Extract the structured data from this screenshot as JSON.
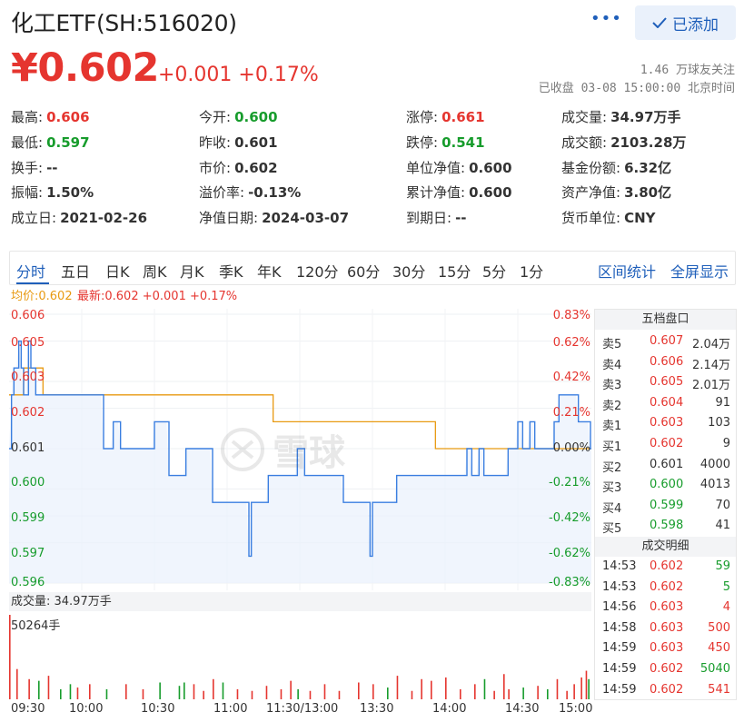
{
  "header": {
    "title": "化工ETF(SH:516020)",
    "more": "•••",
    "added_label": "已添加",
    "price": "¥0.602",
    "change": "+0.001 +0.17%",
    "followers": "1.46 万球友关注",
    "status": "已收盘 03-08 15:00:00 北京时间"
  },
  "quote": {
    "col1": [
      {
        "label": "最高:",
        "value": "0.606",
        "color": "#e5352f"
      },
      {
        "label": "最低:",
        "value": "0.597",
        "color": "#179c2c"
      },
      {
        "label": "换手:",
        "value": "--",
        "color": "#333333"
      },
      {
        "label": "振幅:",
        "value": "1.50%",
        "color": "#333333"
      },
      {
        "label": "成立日:",
        "value": "2021-02-26",
        "color": "#333333"
      }
    ],
    "col2": [
      {
        "label": "今开:",
        "value": "0.600",
        "color": "#179c2c"
      },
      {
        "label": "昨收:",
        "value": "0.601",
        "color": "#333333"
      },
      {
        "label": "市价:",
        "value": "0.602",
        "color": "#333333"
      },
      {
        "label": "溢价率:",
        "value": "-0.13%",
        "color": "#333333"
      },
      {
        "label": "净值日期:",
        "value": "2024-03-07",
        "color": "#333333"
      }
    ],
    "col3": [
      {
        "label": "涨停:",
        "value": "0.661",
        "color": "#e5352f"
      },
      {
        "label": "跌停:",
        "value": "0.541",
        "color": "#179c2c"
      },
      {
        "label": "单位净值:",
        "value": "0.600",
        "color": "#333333"
      },
      {
        "label": "累计净值:",
        "value": "0.600",
        "color": "#333333"
      },
      {
        "label": "到期日:",
        "value": "--",
        "color": "#333333"
      }
    ],
    "col4": [
      {
        "label": "成交量:",
        "value": "34.97万手",
        "color": "#333333"
      },
      {
        "label": "成交额:",
        "value": "2103.28万",
        "color": "#333333"
      },
      {
        "label": "基金份额:",
        "value": "6.32亿",
        "color": "#333333"
      },
      {
        "label": "资产净值:",
        "value": "3.80亿",
        "color": "#333333"
      },
      {
        "label": "货币单位:",
        "value": "CNY",
        "color": "#333333"
      }
    ]
  },
  "tabs": [
    "分时",
    "五日",
    "日K",
    "周K",
    "月K",
    "季K",
    "年K",
    "120分",
    "60分",
    "30分",
    "15分",
    "5分",
    "1分"
  ],
  "tab_links": [
    "区间统计",
    "全屏显示"
  ],
  "chart_header": {
    "avg": "均价:0.602",
    "latest": "最新:0.602 +0.001 +0.17%"
  },
  "watermark": "雪球",
  "chart_data": {
    "type": "line",
    "x_ticks": [
      "09:30",
      "10:00",
      "10:30",
      "11:00",
      "11:30/13:00",
      "13:30",
      "14:00",
      "14:30",
      "15:00"
    ],
    "y_left_ticks": [
      "0.606",
      "0.605",
      "0.603",
      "0.602",
      "0.601",
      "0.600",
      "0.599",
      "0.597",
      "0.596"
    ],
    "y_right_ticks": [
      "0.83%",
      "0.62%",
      "0.42%",
      "0.21%",
      "0.00%",
      "-0.21%",
      "-0.42%",
      "-0.62%",
      "-0.83%"
    ],
    "ylim": [
      0.596,
      0.606
    ],
    "prev_close": 0.601,
    "series": [
      {
        "name": "最新",
        "color": "#3a7ee0",
        "values": [
          0.601,
          0.603,
          0.604,
          0.604,
          0.605,
          0.604,
          0.603,
          0.603,
          0.605,
          0.604,
          0.604,
          0.603,
          0.603,
          0.603,
          0.603,
          0.603,
          0.603,
          0.603,
          0.603,
          0.603,
          0.603,
          0.603,
          0.603,
          0.603,
          0.603,
          0.603,
          0.603,
          0.603,
          0.603,
          0.603,
          0.603,
          0.603,
          0.603,
          0.603,
          0.603,
          0.603,
          0.603,
          0.603,
          0.603,
          0.601,
          0.601,
          0.601,
          0.601,
          0.602,
          0.602,
          0.602,
          0.601,
          0.601,
          0.601,
          0.601,
          0.601,
          0.601,
          0.601,
          0.601,
          0.601,
          0.601,
          0.601,
          0.601,
          0.601,
          0.601,
          0.602,
          0.602,
          0.602,
          0.602,
          0.602,
          0.602,
          0.6,
          0.6,
          0.6,
          0.6,
          0.6,
          0.6,
          0.6,
          0.601,
          0.601,
          0.601,
          0.601,
          0.601,
          0.601,
          0.601,
          0.601,
          0.601,
          0.601,
          0.601,
          0.599,
          0.599,
          0.599,
          0.599,
          0.599,
          0.599,
          0.599,
          0.599,
          0.599,
          0.599,
          0.599,
          0.599,
          0.599,
          0.599,
          0.599,
          0.597,
          0.599,
          0.599,
          0.599,
          0.599,
          0.599,
          0.599,
          0.599,
          0.6,
          0.6,
          0.6,
          0.6,
          0.6,
          0.6,
          0.6,
          0.6,
          0.6,
          0.6,
          0.6,
          0.6,
          0.601,
          0.601,
          0.601,
          0.6,
          0.6,
          0.6,
          0.6,
          0.6,
          0.6,
          0.6,
          0.6,
          0.6,
          0.6,
          0.6,
          0.6,
          0.6,
          0.6,
          0.6,
          0.6,
          0.599,
          0.599,
          0.599,
          0.599,
          0.599,
          0.599,
          0.599,
          0.599,
          0.599,
          0.599,
          0.599,
          0.597,
          0.599,
          0.599,
          0.599,
          0.599,
          0.599,
          0.599,
          0.599,
          0.599,
          0.599,
          0.599,
          0.6,
          0.6,
          0.6,
          0.6,
          0.6,
          0.6,
          0.6,
          0.6,
          0.6,
          0.6,
          0.6,
          0.6,
          0.6,
          0.6,
          0.6,
          0.6,
          0.6,
          0.6,
          0.6,
          0.6,
          0.6,
          0.6,
          0.6,
          0.6,
          0.6,
          0.6,
          0.6,
          0.6,
          0.6,
          0.601,
          0.601,
          0.6,
          0.6,
          0.6,
          0.601,
          0.601,
          0.6,
          0.6,
          0.6,
          0.6,
          0.6,
          0.6,
          0.6,
          0.6,
          0.6,
          0.6,
          0.601,
          0.601,
          0.601,
          0.601,
          0.602,
          0.602,
          0.601,
          0.601,
          0.601,
          0.602,
          0.602,
          0.601,
          0.601,
          0.601,
          0.601,
          0.601,
          0.601,
          0.601,
          0.601,
          0.602,
          0.602,
          0.603,
          0.603,
          0.603,
          0.603,
          0.603,
          0.603,
          0.603,
          0.603,
          0.602,
          0.602,
          0.602,
          0.602,
          0.602,
          0.601,
          0.602,
          0.601,
          0.602,
          0.602,
          0.603,
          0.603,
          0.602,
          0.602,
          0.602
        ]
      },
      {
        "name": "均价",
        "color": "#e89a12",
        "values": [
          0.603,
          0.603,
          0.603,
          0.603,
          0.603,
          0.603,
          0.604,
          0.604,
          0.604,
          0.604,
          0.604,
          0.604,
          0.604,
          0.604,
          0.603,
          0.603,
          0.603,
          0.603,
          0.603,
          0.603,
          0.603,
          0.603,
          0.603,
          0.603,
          0.603,
          0.603,
          0.603,
          0.603,
          0.603,
          0.603,
          0.603,
          0.603,
          0.603,
          0.603,
          0.603,
          0.603,
          0.603,
          0.603,
          0.603,
          0.603,
          0.603,
          0.603,
          0.603,
          0.603,
          0.603,
          0.603,
          0.603,
          0.603,
          0.603,
          0.603,
          0.603,
          0.603,
          0.603,
          0.603,
          0.603,
          0.603,
          0.603,
          0.603,
          0.603,
          0.603,
          0.603,
          0.603,
          0.603,
          0.603,
          0.603,
          0.603,
          0.603,
          0.603,
          0.603,
          0.603,
          0.603,
          0.603,
          0.603,
          0.603,
          0.603,
          0.603,
          0.603,
          0.603,
          0.603,
          0.603,
          0.603,
          0.603,
          0.603,
          0.603,
          0.603,
          0.603,
          0.603,
          0.603,
          0.603,
          0.603,
          0.603,
          0.603,
          0.603,
          0.603,
          0.603,
          0.603,
          0.603,
          0.603,
          0.603,
          0.603,
          0.603,
          0.603,
          0.603,
          0.603,
          0.603,
          0.603,
          0.603,
          0.603,
          0.603,
          0.602,
          0.602,
          0.602,
          0.602,
          0.602,
          0.602,
          0.602,
          0.602,
          0.602,
          0.602,
          0.602,
          0.602,
          0.602,
          0.602,
          0.602,
          0.602,
          0.602,
          0.602,
          0.602,
          0.602,
          0.602,
          0.602,
          0.602,
          0.602,
          0.602,
          0.602,
          0.602,
          0.602,
          0.602,
          0.602,
          0.602,
          0.602,
          0.602,
          0.602,
          0.602,
          0.602,
          0.602,
          0.602,
          0.602,
          0.602,
          0.602,
          0.602,
          0.602,
          0.602,
          0.602,
          0.602,
          0.602,
          0.602,
          0.602,
          0.602,
          0.602,
          0.602,
          0.602,
          0.602,
          0.602,
          0.602,
          0.602,
          0.602,
          0.602,
          0.602,
          0.602,
          0.602,
          0.602,
          0.602,
          0.602,
          0.602,
          0.602,
          0.601,
          0.601,
          0.601,
          0.601,
          0.601,
          0.601,
          0.601,
          0.601,
          0.601,
          0.601,
          0.601,
          0.601,
          0.601,
          0.601,
          0.601,
          0.601,
          0.601,
          0.601,
          0.601,
          0.601,
          0.601,
          0.601,
          0.601,
          0.601,
          0.601,
          0.601,
          0.601,
          0.601,
          0.601,
          0.601,
          0.601,
          0.601,
          0.601,
          0.601,
          0.601,
          0.601,
          0.601,
          0.601,
          0.601,
          0.601,
          0.601,
          0.601,
          0.601,
          0.601,
          0.601,
          0.601,
          0.601,
          0.601,
          0.601,
          0.601,
          0.601,
          0.601,
          0.601,
          0.601,
          0.601,
          0.601,
          0.601,
          0.601,
          0.601,
          0.601,
          0.601,
          0.601,
          0.601,
          0.601,
          0.601,
          0.601,
          0.601,
          0.601,
          0.601,
          0.601,
          0.601,
          0.601
        ]
      }
    ],
    "volume_label": "成交量: 34.97万手",
    "volume_max_label": "50264手",
    "volume_max": 50264,
    "volume": [
      {
        "i": 0,
        "v": 50264,
        "c": "red"
      },
      {
        "i": 3,
        "v": 18000,
        "c": "red"
      },
      {
        "i": 8,
        "v": 12000,
        "c": "red"
      },
      {
        "i": 12,
        "v": 11000,
        "c": "green"
      },
      {
        "i": 16,
        "v": 14000,
        "c": "red"
      },
      {
        "i": 21,
        "v": 6000,
        "c": "green"
      },
      {
        "i": 25,
        "v": 9000,
        "c": "green"
      },
      {
        "i": 28,
        "v": 7000,
        "c": "red"
      },
      {
        "i": 33,
        "v": 9000,
        "c": "red"
      },
      {
        "i": 40,
        "v": 6000,
        "c": "green"
      },
      {
        "i": 48,
        "v": 9000,
        "c": "red"
      },
      {
        "i": 55,
        "v": 6000,
        "c": "red"
      },
      {
        "i": 62,
        "v": 10000,
        "c": "green"
      },
      {
        "i": 70,
        "v": 8000,
        "c": "green"
      },
      {
        "i": 72,
        "v": 10000,
        "c": "green"
      },
      {
        "i": 76,
        "v": 9000,
        "c": "red"
      },
      {
        "i": 80,
        "v": 5000,
        "c": "red"
      },
      {
        "i": 84,
        "v": 12000,
        "c": "red"
      },
      {
        "i": 88,
        "v": 10000,
        "c": "green"
      },
      {
        "i": 94,
        "v": 6000,
        "c": "red"
      },
      {
        "i": 100,
        "v": 5000,
        "c": "red"
      },
      {
        "i": 106,
        "v": 8000,
        "c": "red"
      },
      {
        "i": 112,
        "v": 6000,
        "c": "red"
      },
      {
        "i": 116,
        "v": 11000,
        "c": "red"
      },
      {
        "i": 119,
        "v": 6000,
        "c": "green"
      },
      {
        "i": 124,
        "v": 5000,
        "c": "red"
      },
      {
        "i": 130,
        "v": 9000,
        "c": "red"
      },
      {
        "i": 136,
        "v": 5000,
        "c": "red"
      },
      {
        "i": 144,
        "v": 10000,
        "c": "red"
      },
      {
        "i": 150,
        "v": 9000,
        "c": "red"
      },
      {
        "i": 156,
        "v": 7000,
        "c": "green"
      },
      {
        "i": 160,
        "v": 14000,
        "c": "red"
      },
      {
        "i": 166,
        "v": 5000,
        "c": "red"
      },
      {
        "i": 170,
        "v": 12000,
        "c": "red"
      },
      {
        "i": 174,
        "v": 11000,
        "c": "red"
      },
      {
        "i": 180,
        "v": 13000,
        "c": "red"
      },
      {
        "i": 186,
        "v": 6000,
        "c": "red"
      },
      {
        "i": 192,
        "v": 9000,
        "c": "red"
      },
      {
        "i": 196,
        "v": 12000,
        "c": "green"
      },
      {
        "i": 200,
        "v": 5000,
        "c": "red"
      },
      {
        "i": 204,
        "v": 15000,
        "c": "red"
      },
      {
        "i": 206,
        "v": 6000,
        "c": "red"
      },
      {
        "i": 212,
        "v": 7000,
        "c": "green"
      },
      {
        "i": 218,
        "v": 8000,
        "c": "red"
      },
      {
        "i": 222,
        "v": 6000,
        "c": "green"
      },
      {
        "i": 226,
        "v": 12000,
        "c": "red"
      },
      {
        "i": 230,
        "v": 5000,
        "c": "red"
      },
      {
        "i": 233,
        "v": 9000,
        "c": "red"
      },
      {
        "i": 236,
        "v": 13000,
        "c": "red"
      },
      {
        "i": 238,
        "v": 17000,
        "c": "red"
      },
      {
        "i": 239,
        "v": 12000,
        "c": "green"
      }
    ]
  },
  "order_book": {
    "title": "五档盘口",
    "rows": [
      {
        "label": "卖5",
        "price": "0.607",
        "vol": "2.04万",
        "color": "#e5352f"
      },
      {
        "label": "卖4",
        "price": "0.606",
        "vol": "2.14万",
        "color": "#e5352f"
      },
      {
        "label": "卖3",
        "price": "0.605",
        "vol": "2.01万",
        "color": "#e5352f"
      },
      {
        "label": "卖2",
        "price": "0.604",
        "vol": "91",
        "color": "#e5352f"
      },
      {
        "label": "卖1",
        "price": "0.603",
        "vol": "103",
        "color": "#e5352f"
      },
      {
        "label": "买1",
        "price": "0.602",
        "vol": "9",
        "color": "#e5352f"
      },
      {
        "label": "买2",
        "price": "0.601",
        "vol": "4000",
        "color": "#333333"
      },
      {
        "label": "买3",
        "price": "0.600",
        "vol": "4013",
        "color": "#179c2c"
      },
      {
        "label": "买4",
        "price": "0.599",
        "vol": "70",
        "color": "#179c2c"
      },
      {
        "label": "买5",
        "price": "0.598",
        "vol": "41",
        "color": "#179c2c"
      }
    ]
  },
  "trades": {
    "title": "成交明细",
    "rows": [
      {
        "time": "14:53",
        "price": "0.602",
        "vol": "59",
        "color": "#e5352f",
        "vcolor": "#179c2c"
      },
      {
        "time": "14:53",
        "price": "0.602",
        "vol": "5",
        "color": "#e5352f",
        "vcolor": "#179c2c"
      },
      {
        "time": "14:56",
        "price": "0.603",
        "vol": "4",
        "color": "#e5352f",
        "vcolor": "#e5352f"
      },
      {
        "time": "14:58",
        "price": "0.603",
        "vol": "500",
        "color": "#e5352f",
        "vcolor": "#e5352f"
      },
      {
        "time": "14:59",
        "price": "0.603",
        "vol": "450",
        "color": "#e5352f",
        "vcolor": "#e5352f"
      },
      {
        "time": "14:59",
        "price": "0.602",
        "vol": "5040",
        "color": "#e5352f",
        "vcolor": "#179c2c"
      },
      {
        "time": "14:59",
        "price": "0.602",
        "vol": "541",
        "color": "#e5352f",
        "vcolor": "#e5352f"
      }
    ]
  }
}
